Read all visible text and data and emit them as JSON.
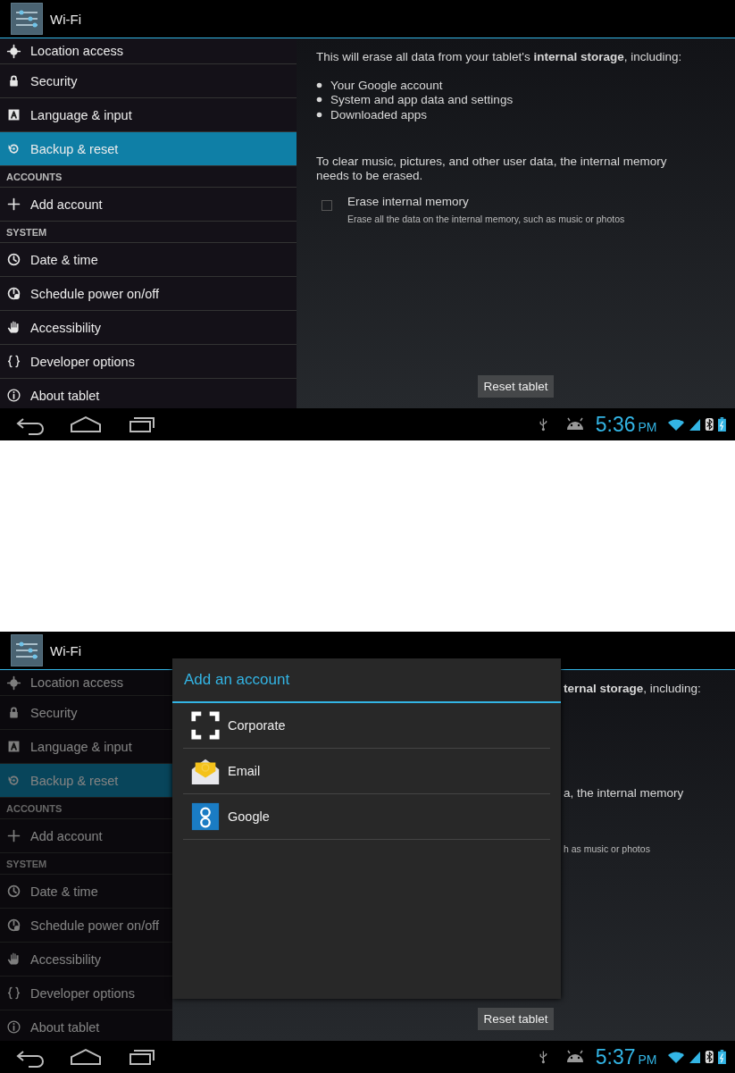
{
  "screens": [
    {
      "action_bar": {
        "title": "Wi-Fi"
      },
      "dimmed": false,
      "sidebar": {
        "items": [
          {
            "kind": "item",
            "label": "Location access",
            "selected": false
          },
          {
            "kind": "item",
            "label": "Security",
            "selected": false
          },
          {
            "kind": "item",
            "label": "Language & input",
            "selected": false
          },
          {
            "kind": "item",
            "label": "Backup & reset",
            "selected": true
          },
          {
            "kind": "header",
            "label": "ACCOUNTS"
          },
          {
            "kind": "item",
            "label": "Add account",
            "selected": false
          },
          {
            "kind": "header",
            "label": "SYSTEM"
          },
          {
            "kind": "item",
            "label": "Date & time",
            "selected": false
          },
          {
            "kind": "item",
            "label": "Schedule power on/off",
            "selected": false
          },
          {
            "kind": "item",
            "label": "Accessibility",
            "selected": false
          },
          {
            "kind": "item",
            "label": "Developer options",
            "selected": false
          },
          {
            "kind": "item",
            "label": "About tablet",
            "selected": false
          }
        ]
      },
      "content": {
        "kind": "full",
        "intro": "This will erase all data from your tablet's **internal storage**, including:",
        "bullets": [
          "Your Google account",
          "System and app data and settings",
          "Downloaded apps"
        ],
        "note": "To clear music, pictures, and other user data, the internal memory needs to be erased.",
        "checkbox": {
          "label": "Erase internal memory",
          "description": "Erase all the data on the internal memory, such as music or photos",
          "checked": false
        },
        "button": "Reset tablet"
      },
      "nav_bar": {
        "time": "5:36",
        "ampm": "PM"
      }
    },
    {
      "action_bar": {
        "title": "Wi-Fi"
      },
      "dimmed": true,
      "sidebar": {
        "items": [
          {
            "kind": "item",
            "label": "Location access",
            "selected": false
          },
          {
            "kind": "item",
            "label": "Security",
            "selected": false
          },
          {
            "kind": "item",
            "label": "Language & input",
            "selected": false
          },
          {
            "kind": "item",
            "label": "Backup & reset",
            "selected": true
          },
          {
            "kind": "header",
            "label": "ACCOUNTS"
          },
          {
            "kind": "item",
            "label": "Add account",
            "selected": false
          },
          {
            "kind": "header",
            "label": "SYSTEM"
          },
          {
            "kind": "item",
            "label": "Date & time",
            "selected": false
          },
          {
            "kind": "item",
            "label": "Schedule power on/off",
            "selected": false
          },
          {
            "kind": "item",
            "label": "Accessibility",
            "selected": false
          },
          {
            "kind": "item",
            "label": "Developer options",
            "selected": false
          },
          {
            "kind": "item",
            "label": "About tablet",
            "selected": false
          }
        ]
      },
      "content": {
        "kind": "covered",
        "intro": "**ternal storage**, including:",
        "note": "a, the internal memory",
        "description": "h as music or photos",
        "button": "Reset tablet"
      },
      "dialog": {
        "title": "Add an account",
        "items": [
          {
            "label": "Corporate"
          },
          {
            "label": "Email"
          },
          {
            "label": "Google"
          }
        ]
      },
      "nav_bar": {
        "time": "5:37",
        "ampm": "PM"
      }
    }
  ]
}
